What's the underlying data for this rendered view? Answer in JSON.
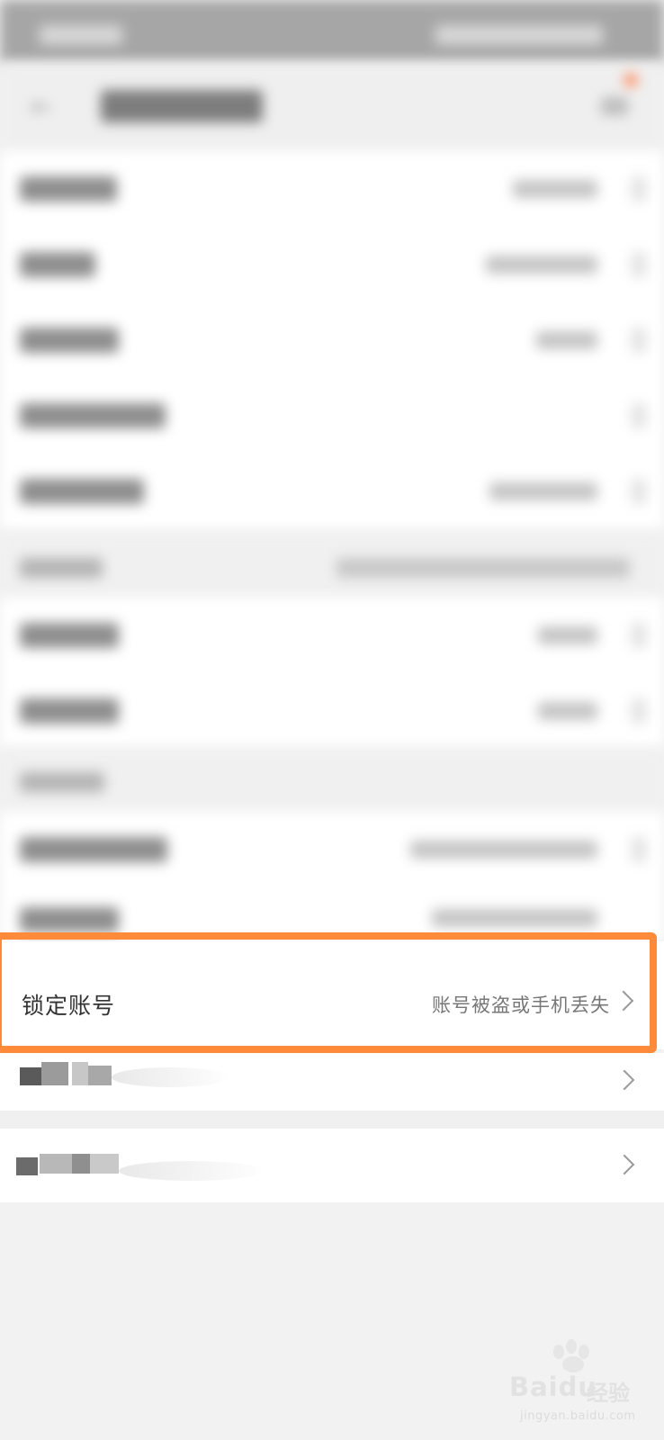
{
  "lock_account": {
    "label": "锁定账号",
    "subtitle": "账号被盗或手机丢失"
  },
  "watermark": {
    "brand": "Baidu",
    "brand_cn": "经验",
    "url": "jingyan.baidu.com"
  },
  "colors": {
    "highlight": "#ff8a3a",
    "background": "#f2f2f2",
    "row_background": "#ffffff"
  },
  "icons": {
    "row_chevron": "chevron-right-icon",
    "back": "back-arrow-icon"
  }
}
